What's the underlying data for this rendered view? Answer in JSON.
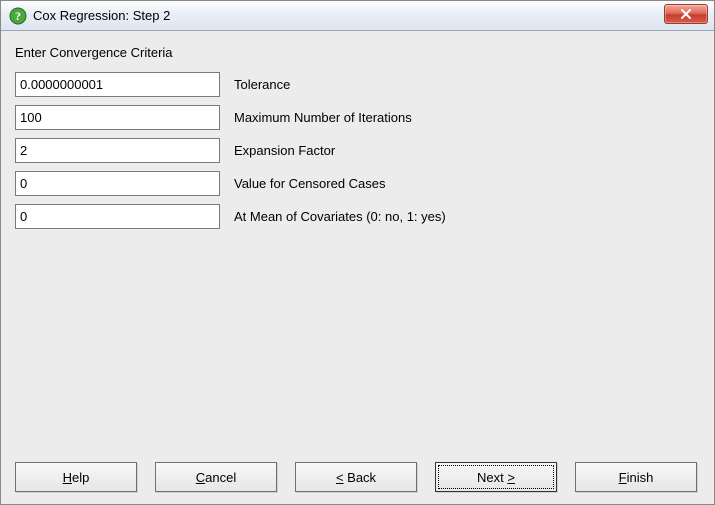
{
  "window": {
    "title": "Cox Regression: Step 2",
    "close_symbol": "✕"
  },
  "instruction": "Enter Convergence Criteria",
  "fields": {
    "tolerance": {
      "value": "0.0000000001",
      "label": "Tolerance"
    },
    "iterations": {
      "value": "100",
      "label": "Maximum Number of Iterations"
    },
    "expansion": {
      "value": "2",
      "label": "Expansion Factor"
    },
    "censored": {
      "value": "0",
      "label": "Value for Censored Cases"
    },
    "atmean": {
      "value": "0",
      "label": "At Mean of Covariates (0: no, 1: yes)"
    }
  },
  "buttons": {
    "help_pre": "",
    "help_mn": "H",
    "help_post": "elp",
    "cancel_pre": "",
    "cancel_mn": "C",
    "cancel_post": "ancel",
    "back_pre": "",
    "back_mn": "<",
    "back_mid": " Back",
    "next_pre": "Next ",
    "next_mn": ">",
    "next_post": "",
    "finish_pre": "",
    "finish_mn": "F",
    "finish_post": "inish"
  }
}
